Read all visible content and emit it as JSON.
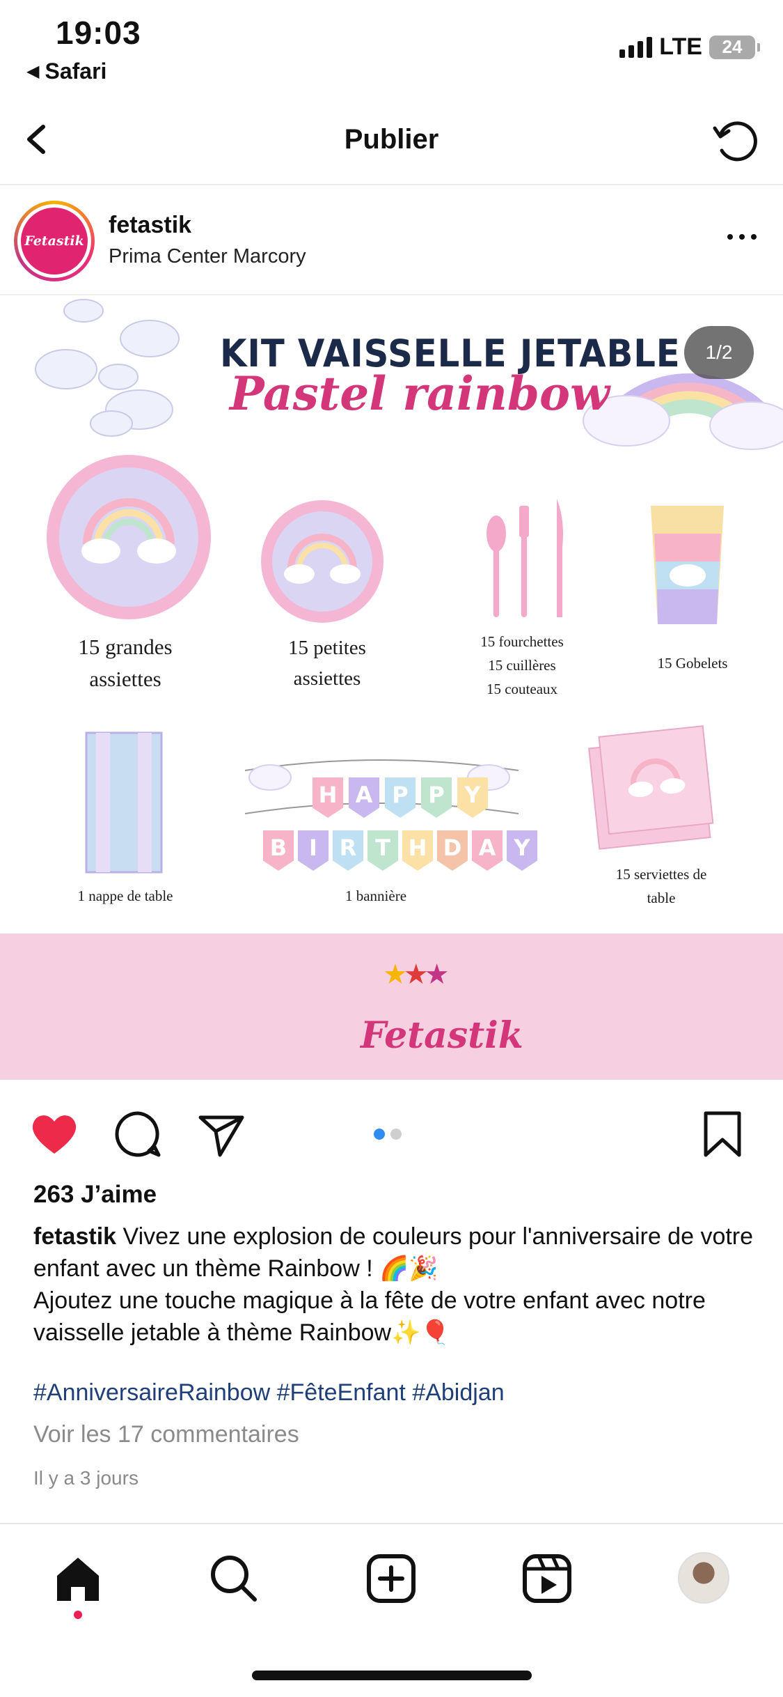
{
  "status_bar": {
    "time": "19:03",
    "back_app": "Safari",
    "network": "LTE",
    "battery": "24"
  },
  "nav": {
    "title": "Publier"
  },
  "post": {
    "username": "fetastik",
    "location": "Prima Center Marcory",
    "avatar_text": "Fetastik",
    "image": {
      "page_indicator": "1/2",
      "title_line1": "KIT VAISSELLE JETABLE",
      "title_line2": "Pastel rainbow",
      "items": {
        "big_plates_l1": "15 grandes",
        "big_plates_l2": "assiettes",
        "small_plates_l1": "15 petites",
        "small_plates_l2": "assiettes",
        "forks": "15 fourchettes",
        "spoons": "15 cuillères",
        "knives": "15 couteaux",
        "cups": "15 Gobelets",
        "tablecloth": "1 nappe de table",
        "banner": "1 bannière",
        "napkins_l1": "15 serviettes de",
        "napkins_l2": "table"
      },
      "banner_letters_row1": [
        "H",
        "A",
        "P",
        "P",
        "Y"
      ],
      "banner_letters_row2": [
        "B",
        "I",
        "R",
        "T",
        "H",
        "D",
        "A",
        "Y"
      ],
      "brand_logo": "Fetastik"
    },
    "likes": "263 J’aime",
    "caption_user": "fetastik",
    "caption_text_1": "Vivez une explosion de couleurs pour l'anniversaire de votre enfant avec un thème Rainbow ! 🌈🎉",
    "caption_text_2": "Ajoutez une touche magique à la fête de votre enfant avec notre vaisselle jetable à thème Rainbow✨🎈",
    "hashtags": "#AnniversaireRainbow #FêteEnfant #Abidjan",
    "comments_link": "Voir les 17 commentaires",
    "time_ago": "Il y a 3 jours"
  },
  "colors": {
    "like_red": "#ee2a4a",
    "accent_blue": "#2f8cf0",
    "hashtag_blue": "#1f3f7a",
    "brand_pink": "#d4367a"
  },
  "icons": {
    "actions": [
      "heart-icon",
      "comment-icon",
      "share-icon",
      "bookmark-icon"
    ],
    "tabs": [
      "home-icon",
      "search-icon",
      "add-post-icon",
      "reels-icon",
      "profile-avatar"
    ]
  }
}
